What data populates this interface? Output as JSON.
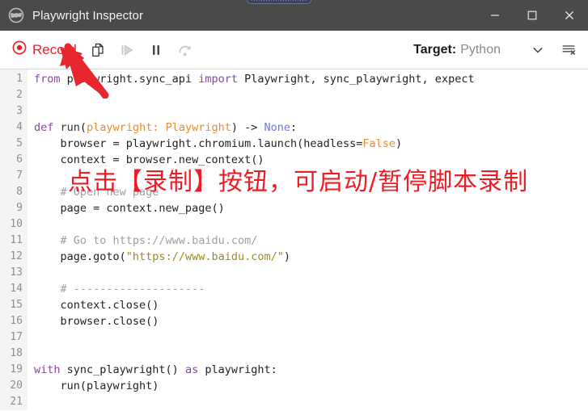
{
  "window": {
    "title": "Playwright Inspector",
    "app_icon": "globe-icon",
    "controls": {
      "minimize": "—",
      "maximize": "☐",
      "close": "✕"
    }
  },
  "toolbar": {
    "record_label": "Record",
    "record_icon": "record-circle-icon",
    "copy_icon": "copy-icon",
    "resume_icon": "resume-play-icon",
    "pause_icon": "pause-icon",
    "step_over_icon": "step-over-icon",
    "target_label": "Target:",
    "target_value": "Python",
    "chevron_icon": "chevron-down-icon",
    "clear_log_icon": "clear-log-icon",
    "accent_red": "#e8222b",
    "disabled_gray": "#c8c8c8"
  },
  "annotation": {
    "text": "点击【录制】按钮，可启动/暂停脚本录制",
    "color": "#ee1c25",
    "arrow": "red-arrow-pointing-to-record-button"
  },
  "editor": {
    "language": "python",
    "line_count": 21,
    "lines": [
      {
        "n": 1,
        "tokens": [
          {
            "t": "from ",
            "c": "kw"
          },
          {
            "t": "playwright.sync_api ",
            "c": "code"
          },
          {
            "t": "import ",
            "c": "kw"
          },
          {
            "t": "Playwright, sync_playwright, expect",
            "c": "code"
          }
        ]
      },
      {
        "n": 2,
        "tokens": []
      },
      {
        "n": 3,
        "tokens": []
      },
      {
        "n": 4,
        "tokens": [
          {
            "t": "def ",
            "c": "kw"
          },
          {
            "t": "run",
            "c": "fn"
          },
          {
            "t": "(",
            "c": "code"
          },
          {
            "t": "playwright: Playwright",
            "c": "par"
          },
          {
            "t": ") -> ",
            "c": "code"
          },
          {
            "t": "None",
            "c": "bi"
          },
          {
            "t": ":",
            "c": "code"
          }
        ]
      },
      {
        "n": 5,
        "tokens": [
          {
            "t": "    browser = playwright.chromium.launch(headless=",
            "c": "code"
          },
          {
            "t": "False",
            "c": "num"
          },
          {
            "t": ")",
            "c": "code"
          }
        ]
      },
      {
        "n": 6,
        "tokens": [
          {
            "t": "    context = browser.new_context()",
            "c": "code"
          }
        ]
      },
      {
        "n": 7,
        "tokens": []
      },
      {
        "n": 8,
        "tokens": [
          {
            "t": "    # Open new page",
            "c": "com"
          }
        ]
      },
      {
        "n": 9,
        "tokens": [
          {
            "t": "    page = context.new_page()",
            "c": "code"
          }
        ]
      },
      {
        "n": 10,
        "tokens": []
      },
      {
        "n": 11,
        "tokens": [
          {
            "t": "    # Go to https://www.baidu.com/",
            "c": "com"
          }
        ]
      },
      {
        "n": 12,
        "tokens": [
          {
            "t": "    page.goto(",
            "c": "code"
          },
          {
            "t": "\"https://www.baidu.com/\"",
            "c": "str"
          },
          {
            "t": ")",
            "c": "code"
          }
        ]
      },
      {
        "n": 13,
        "tokens": []
      },
      {
        "n": 14,
        "tokens": [
          {
            "t": "    # --------------------",
            "c": "com"
          }
        ]
      },
      {
        "n": 15,
        "tokens": [
          {
            "t": "    context.close()",
            "c": "code"
          }
        ]
      },
      {
        "n": 16,
        "tokens": [
          {
            "t": "    browser.close()",
            "c": "code"
          }
        ]
      },
      {
        "n": 17,
        "tokens": []
      },
      {
        "n": 18,
        "tokens": []
      },
      {
        "n": 19,
        "tokens": [
          {
            "t": "with ",
            "c": "kw"
          },
          {
            "t": "sync_playwright() ",
            "c": "code"
          },
          {
            "t": "as ",
            "c": "kw"
          },
          {
            "t": "playwright:",
            "c": "code"
          }
        ]
      },
      {
        "n": 20,
        "tokens": [
          {
            "t": "    run(playwright)",
            "c": "code"
          }
        ]
      },
      {
        "n": 21,
        "tokens": []
      }
    ]
  }
}
